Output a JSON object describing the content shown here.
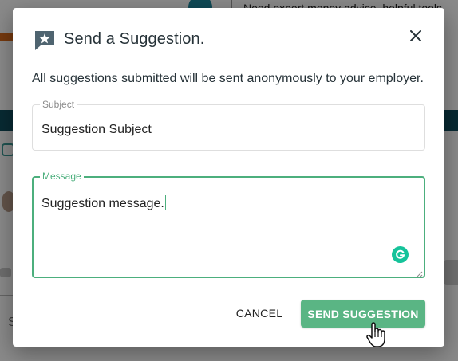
{
  "background": {
    "top_text": "Need expert money advice, helpful tools",
    "side_letter": "S"
  },
  "dialog": {
    "title": "Send a Suggestion.",
    "title_icon": "star-chat-icon",
    "close_icon": "close-icon",
    "description": "All suggestions submitted will be sent anonymously to your employer.",
    "subject": {
      "label": "Subject",
      "value": "Suggestion Subject"
    },
    "message": {
      "label": "Message",
      "value": "Suggestion message."
    },
    "cancel_label": "CANCEL",
    "send_label": "SEND SUGGESTION"
  },
  "colors": {
    "accent_green": "#5ab584",
    "focus_green": "#4caf7d",
    "title_text": "#263238",
    "grammarly": "#15c39a"
  }
}
